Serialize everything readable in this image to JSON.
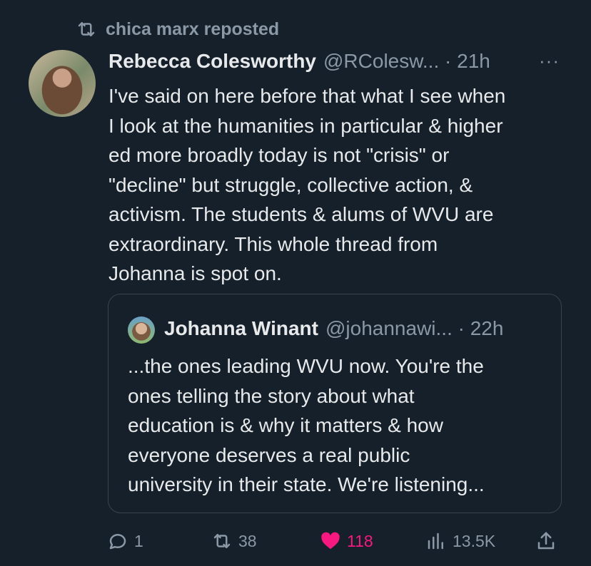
{
  "repost": {
    "icon": "repost-icon",
    "text": "chica marx reposted"
  },
  "tweet": {
    "author_name": "Rebecca Colesworthy",
    "handle_time": "@RColesw... · 21h",
    "more": "···",
    "text": "I've said on here before that what I see when\nI look at the humanities in particular & higher\ned more broadly today is not \"crisis\" or\n\"decline\" but struggle, collective action, &\nactivism. The students & alums of WVU are\nextraordinary. This whole thread from\nJohanna is spot on."
  },
  "quote": {
    "author_name": "Johanna Winant",
    "handle_time": "@johannawi... · 22h",
    "text": "...the ones leading WVU now. You're the\nones telling the story about what\neducation is & why it matters & how\neveryone deserves a real public\nuniversity in their state. We're listening..."
  },
  "actions": {
    "replies": "1",
    "reposts": "38",
    "likes": "118",
    "views": "13.5K"
  },
  "colors": {
    "background": "#15202b",
    "text": "#e7e9ea",
    "secondary": "#8b98a5",
    "like": "#f91880",
    "border": "#38444d"
  }
}
